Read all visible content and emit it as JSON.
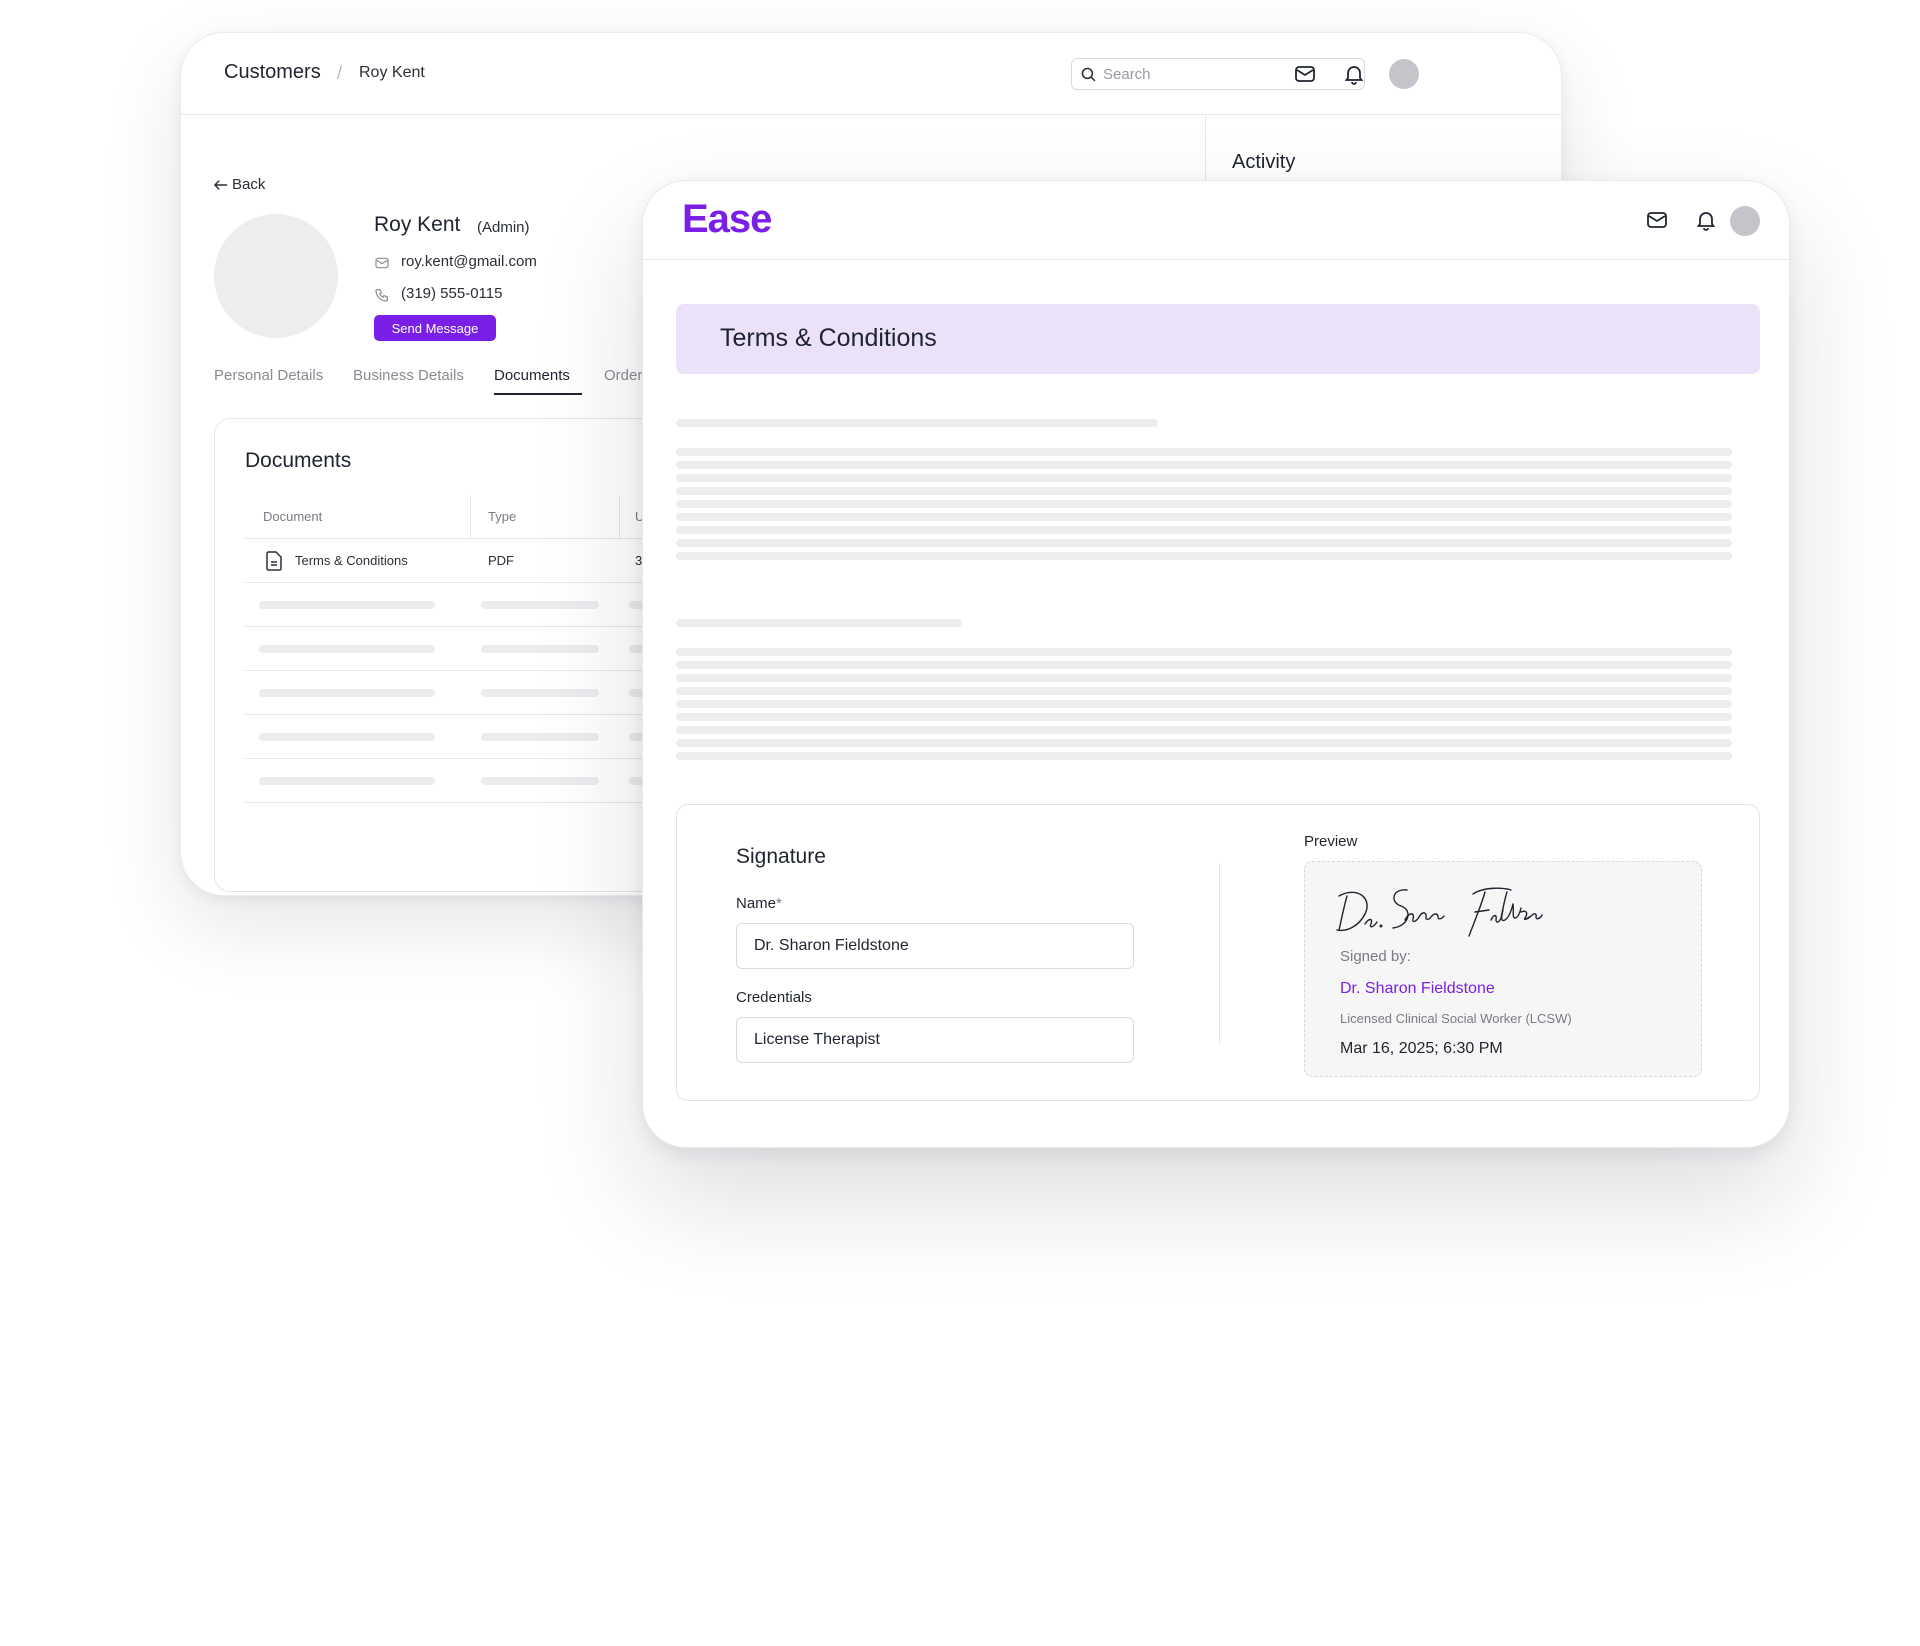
{
  "back_window": {
    "breadcrumb": {
      "root": "Customers",
      "separator": "/",
      "current": "Roy Kent"
    },
    "search": {
      "placeholder": "Search"
    },
    "activity_title": "Activity",
    "back_label": "Back",
    "profile": {
      "name": "Roy Kent",
      "role": "(Admin)",
      "email": "roy.kent@gmail.com",
      "phone": "(319) 555-0115",
      "send_message_label": "Send Message"
    },
    "tabs": [
      "Personal Details",
      "Business Details",
      "Documents",
      "Orders"
    ],
    "active_tab": "Documents",
    "documents": {
      "title": "Documents",
      "columns": [
        "Document",
        "Type",
        "U"
      ],
      "rows": [
        {
          "document": "Terms & Conditions",
          "type": "PDF",
          "third": "3"
        }
      ]
    }
  },
  "front_window": {
    "logo": "Ease",
    "document_title": "Terms & Conditions",
    "signature": {
      "title": "Signature",
      "name_label": "Name",
      "required_mark": "*",
      "name_value": "Dr. Sharon Fieldstone",
      "credentials_label": "Credentials",
      "credentials_value": "License Therapist",
      "preview_label": "Preview",
      "handwritten": "Dr. Sharon Fieldstone",
      "signed_by_label": "Signed by:",
      "signer_name": "Dr. Sharon Fieldstone",
      "signer_credentials": "Licensed Clinical Social Worker (LCSW)",
      "signed_date": "Mar 16, 2025; 6:30 PM"
    }
  },
  "colors": {
    "accent": "#7a1fe6",
    "banner": "#ebe1f8",
    "skeleton": "#ededf0"
  },
  "icons": [
    "search-icon",
    "mail-icon",
    "bell-icon",
    "avatar",
    "arrow-left-icon",
    "phone-icon",
    "file-icon"
  ]
}
